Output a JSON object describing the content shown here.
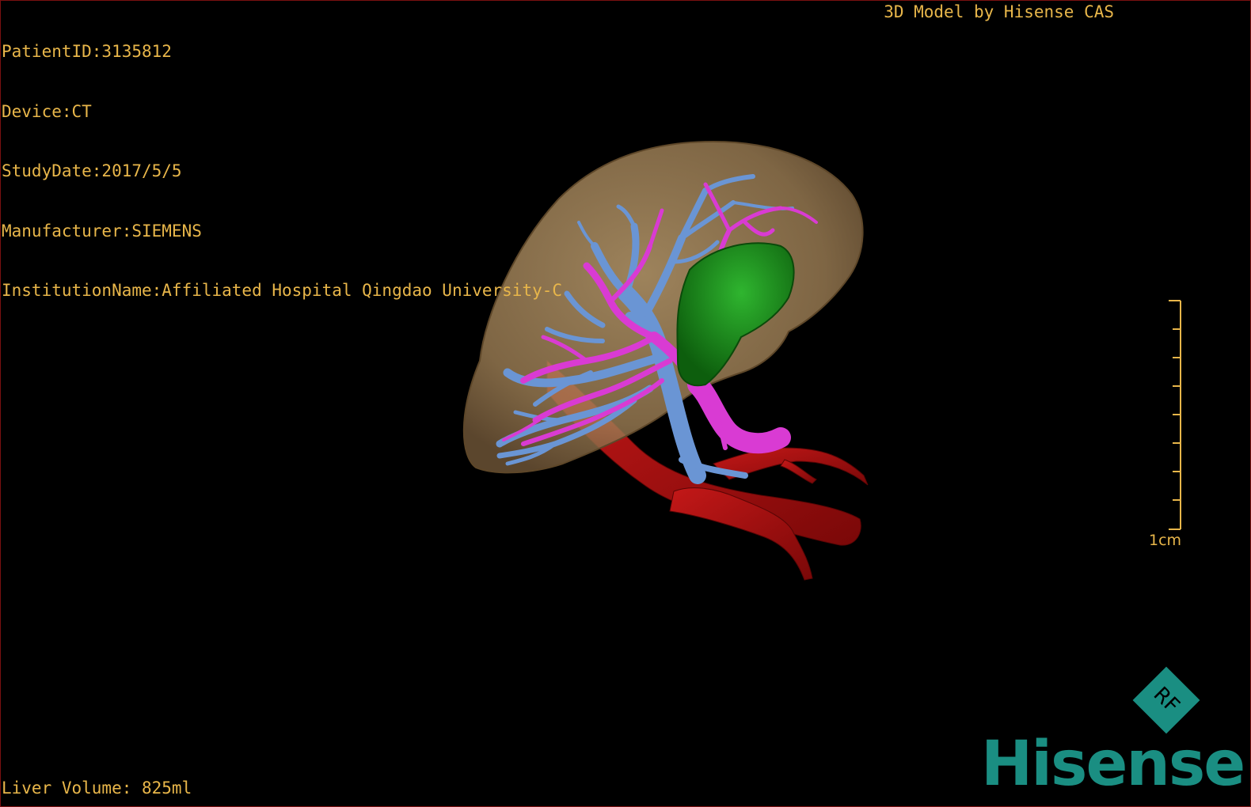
{
  "header": {
    "patient_id": "PatientID:3135812",
    "device": "Device:CT",
    "study_date": "StudyDate:2017/5/5",
    "manufacturer": "Manufacturer:SIEMENS",
    "institution": "InstitutionName:Affiliated Hospital Qingdao University-C"
  },
  "credit": "3D Model by Hisense CAS",
  "footer": {
    "liver_volume": "Liver Volume: 825ml"
  },
  "scale": {
    "label": "1cm",
    "ticks": 9
  },
  "logo": {
    "mark_text": "RF",
    "brand": "Hisense"
  },
  "model_structures": [
    {
      "name": "liver",
      "color": "#b99a6c"
    },
    {
      "name": "hepatic-vein",
      "color": "#6a95d4"
    },
    {
      "name": "portal-vein",
      "color": "#d93bd3"
    },
    {
      "name": "gallbladder",
      "color": "#1a8a1a"
    },
    {
      "name": "vena-cava-aorta",
      "color": "#b01212"
    }
  ],
  "colors": {
    "overlay_text": "#e8b64a",
    "brand": "#1a8e82",
    "background": "#000000",
    "border": "#7a1010"
  }
}
